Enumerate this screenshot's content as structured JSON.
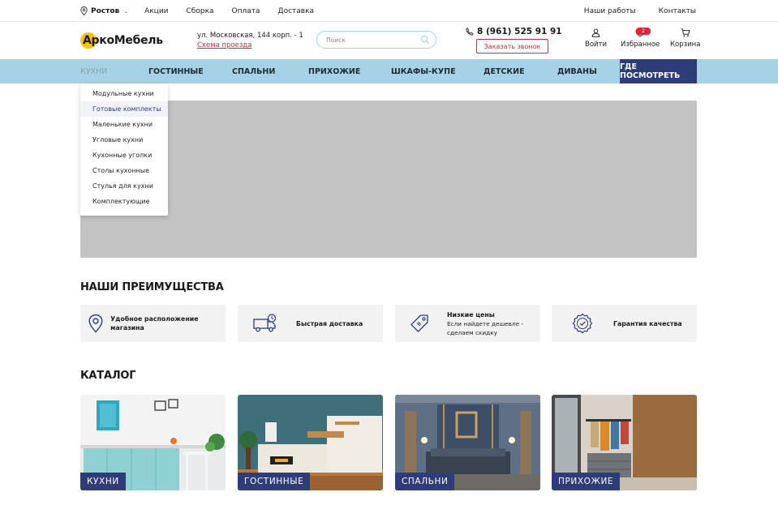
{
  "topbar": {
    "city": "Ростов",
    "links": [
      "Акции",
      "Сборка",
      "Оплата",
      "Доставка"
    ],
    "right_links": [
      "Наши работы",
      "Контакты"
    ]
  },
  "header": {
    "logo": "АркоМебель",
    "address_line": "ул. Московская, 144 корп. - 1",
    "map_link": "Схема проезда",
    "search_placeholder": "Поиск",
    "phone": "8 (961) 525 91 91",
    "callback_label": "Заказать звонок",
    "login_label": "Войти",
    "favorites_label": "Избранное",
    "favorites_count": "2",
    "cart_label": "Корзина"
  },
  "nav": {
    "items": [
      "КУХНИ",
      "ГОСТИННЫЕ",
      "СПАЛЬНИ",
      "ПРИХОЖИЕ",
      "ШКАФЫ-КУПЕ",
      "ДЕТСКИЕ",
      "ДИВАНЫ"
    ],
    "where_label": "ГДЕ ПОСМОТРЕТЬ"
  },
  "dropdown": {
    "items": [
      "Модульные кухни",
      "Готовые комплекты",
      "Маленькие кухни",
      "Угловые кухни",
      "Кухонные уголки",
      "Столы кухонные",
      "Стулья для кухни",
      "Комплектующие"
    ]
  },
  "advantages": {
    "title": "НАШИ ПРЕИМУЩЕСТВА",
    "items": [
      {
        "title": "Удобное расположение магазина",
        "icon": "location-pin-icon"
      },
      {
        "title": "Быстрая доставка",
        "icon": "delivery-truck-icon"
      },
      {
        "title": "Низкие цены",
        "subtitle_line1": "Если найдете дешевле -",
        "subtitle_line2": "сделаем скидку",
        "icon": "price-tag-icon"
      },
      {
        "title": "Гарантия качества",
        "icon": "quality-badge-icon"
      }
    ]
  },
  "catalog": {
    "title": "КАТАЛОГ",
    "items": [
      "КУХНИ",
      "ГОСТИННЫЕ",
      "СПАЛЬНИ",
      "ПРИХОЖИЕ"
    ]
  },
  "colors": {
    "nav_bg": "#a5d2e5",
    "accent_dark": "#2e3c78",
    "accent_red": "#d9263a",
    "logo_yellow": "#f7c300"
  }
}
